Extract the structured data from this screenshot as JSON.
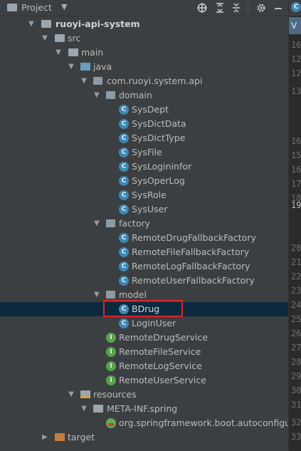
{
  "toolbar": {
    "title": "Project",
    "icons": [
      "folder-icon",
      "caret-down",
      "crosshair-icon",
      "collapse-all-icon",
      "expand-all-icon",
      "gear-icon",
      "minimize-icon"
    ]
  },
  "tree": [
    {
      "label": "ruoyi-api-system",
      "icon": "module-folder",
      "arrow": "down",
      "bold": true
    },
    {
      "label": "src",
      "icon": "folder",
      "arrow": "down"
    },
    {
      "label": "main",
      "icon": "folder",
      "arrow": "down"
    },
    {
      "label": "java",
      "icon": "source-folder",
      "arrow": "down"
    },
    {
      "label": "com.ruoyi.system.api",
      "icon": "package",
      "arrow": "down"
    },
    {
      "label": "domain",
      "icon": "package",
      "arrow": "down"
    },
    {
      "label": "SysDept",
      "icon": "class"
    },
    {
      "label": "SysDictData",
      "icon": "class"
    },
    {
      "label": "SysDictType",
      "icon": "class"
    },
    {
      "label": "SysFile",
      "icon": "class"
    },
    {
      "label": "SysLogininfor",
      "icon": "class"
    },
    {
      "label": "SysOperLog",
      "icon": "class"
    },
    {
      "label": "SysRole",
      "icon": "class"
    },
    {
      "label": "SysUser",
      "icon": "class"
    },
    {
      "label": "factory",
      "icon": "package",
      "arrow": "down"
    },
    {
      "label": "RemoteDrugFallbackFactory",
      "icon": "class"
    },
    {
      "label": "RemoteFileFallbackFactory",
      "icon": "class"
    },
    {
      "label": "RemoteLogFallbackFactory",
      "icon": "class"
    },
    {
      "label": "RemoteUserFallbackFactory",
      "icon": "class"
    },
    {
      "label": "model",
      "icon": "package",
      "arrow": "down"
    },
    {
      "label": "BDrug",
      "icon": "class",
      "selected": true
    },
    {
      "label": "LoginUser",
      "icon": "class"
    },
    {
      "label": "RemoteDrugService",
      "icon": "interface"
    },
    {
      "label": "RemoteFileService",
      "icon": "interface"
    },
    {
      "label": "RemoteLogService",
      "icon": "interface"
    },
    {
      "label": "RemoteUserService",
      "icon": "interface"
    },
    {
      "label": "resources",
      "icon": "resources-folder",
      "arrow": "down"
    },
    {
      "label": "META-INF.spring",
      "icon": "folder",
      "arrow": "down"
    },
    {
      "label": "org.springframework.boot.autoconfigure",
      "icon": "spring-file"
    },
    {
      "label": "target",
      "icon": "excluded-folder",
      "arrow": "right"
    }
  ],
  "editor": {
    "tab_icon": "C",
    "bluebar_text": "V",
    "line_numbers": [
      "16",
      "12",
      "12",
      "13",
      "",
      "16",
      "15",
      "16",
      "17",
      "18",
      "19",
      "",
      "20",
      "21",
      "22",
      "23",
      "24",
      "25",
      "26",
      "27",
      "28",
      "29",
      "30",
      "31",
      "32",
      "33"
    ],
    "current_line": "19"
  },
  "colors": {
    "background": "#3c3f41",
    "selection": "#0d293e",
    "highlight_box": "#e0242a",
    "class_icon": "#3d88b4",
    "interface_icon": "#58a34b"
  }
}
